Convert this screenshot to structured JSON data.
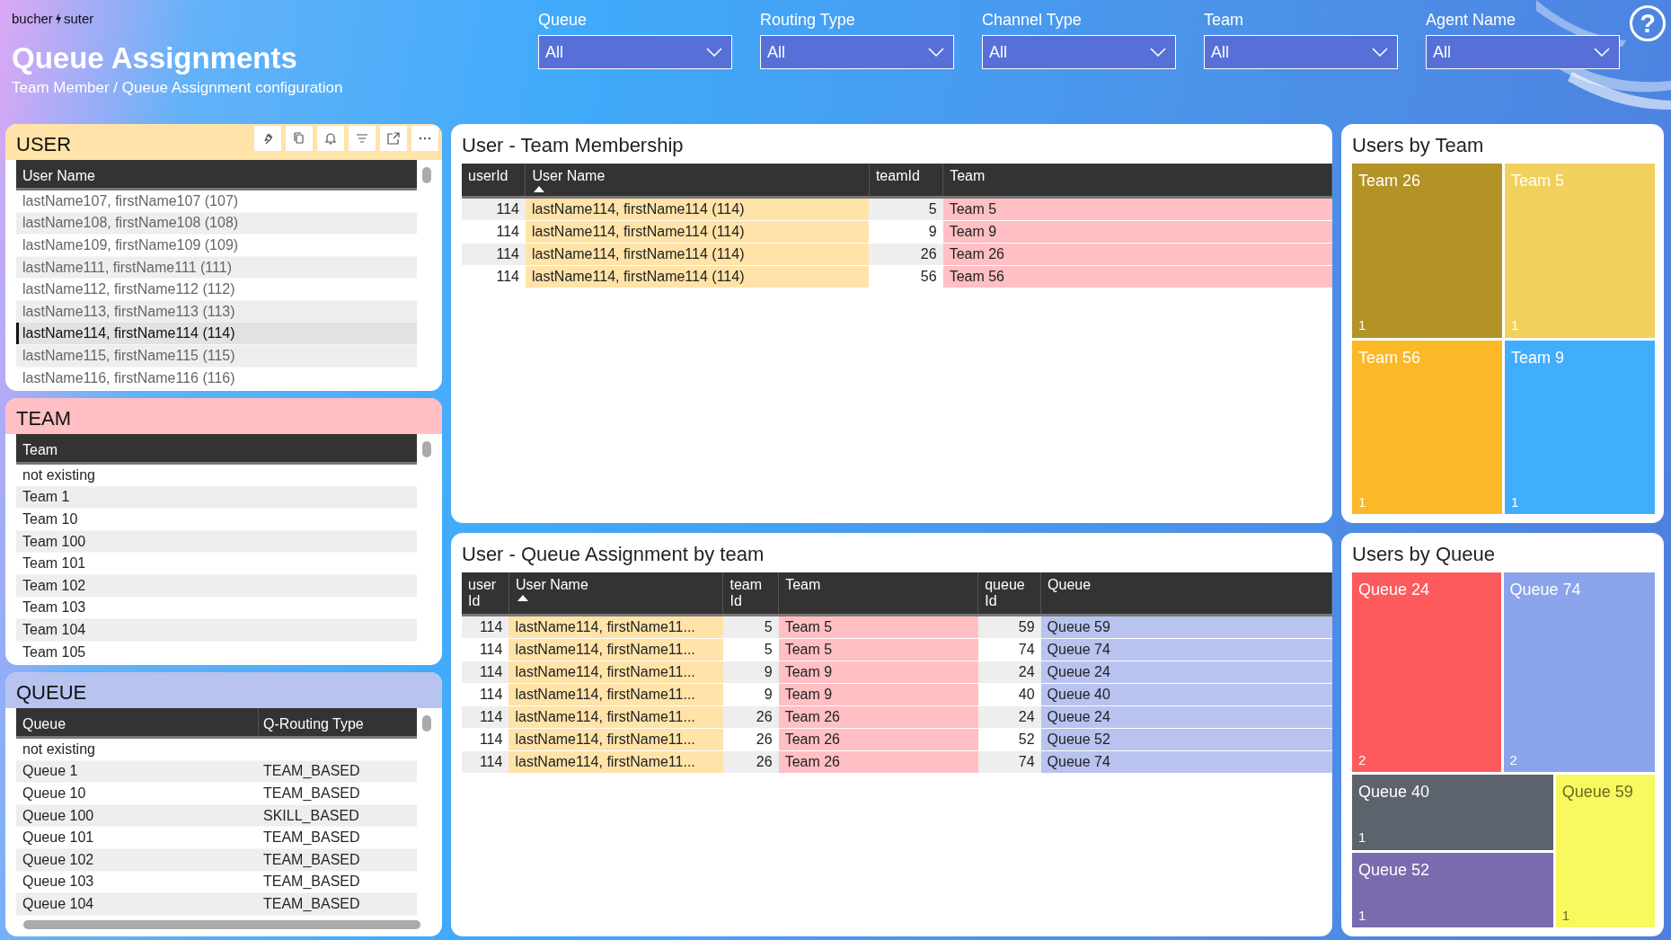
{
  "header": {
    "logo": [
      "bucher",
      "suter"
    ],
    "title": "Queue Assignments",
    "subtitle": "Team Member / Queue Assignment configuration",
    "help": "?"
  },
  "filters": [
    {
      "label": "Queue",
      "value": "All"
    },
    {
      "label": "Routing Type",
      "value": "All"
    },
    {
      "label": "Channel Type",
      "value": "All"
    },
    {
      "label": "Team",
      "value": "All"
    },
    {
      "label": "Agent Name",
      "value": "All"
    }
  ],
  "user_panel": {
    "title": "USER",
    "column": "User Name",
    "items": [
      {
        "text": "lastName107, firstName107 (107)",
        "selected": false
      },
      {
        "text": "lastName108, firstName108 (108)",
        "selected": false
      },
      {
        "text": "lastName109, firstName109 (109)",
        "selected": false
      },
      {
        "text": "lastName111, firstName111 (111)",
        "selected": false
      },
      {
        "text": "lastName112, firstName112 (112)",
        "selected": false
      },
      {
        "text": "lastName113, firstName113 (113)",
        "selected": false
      },
      {
        "text": "lastName114, firstName114 (114)",
        "selected": true
      },
      {
        "text": "lastName115, firstName115 (115)",
        "selected": false
      },
      {
        "text": "lastName116, firstName116 (116)",
        "selected": false
      }
    ]
  },
  "team_panel": {
    "title": "TEAM",
    "column": "Team",
    "items": [
      "not existing",
      "Team 1",
      "Team 10",
      "Team 100",
      "Team 101",
      "Team 102",
      "Team 103",
      "Team 104",
      "Team 105"
    ]
  },
  "queue_panel": {
    "title": "QUEUE",
    "columns": [
      "Queue",
      "Q-Routing Type"
    ],
    "rows": [
      {
        "queue": "not existing"
      },
      {
        "queue": "Queue 1",
        "routing_type": "TEAM_BASED"
      },
      {
        "queue": "Queue 10",
        "routing_type": "TEAM_BASED"
      },
      {
        "queue": "Queue 100",
        "routing_type": "SKILL_BASED"
      },
      {
        "queue": "Queue 101",
        "routing_type": "TEAM_BASED"
      },
      {
        "queue": "Queue 102",
        "routing_type": "TEAM_BASED"
      },
      {
        "queue": "Queue 103",
        "routing_type": "TEAM_BASED"
      },
      {
        "queue": "Queue 104",
        "routing_type": "TEAM_BASED"
      }
    ]
  },
  "membership": {
    "title": "User - Team Membership",
    "columns": [
      {
        "label": "userId",
        "kind": "id"
      },
      {
        "label": "User Name",
        "kind": "name",
        "color": "#ffe3a8",
        "sorted": true
      },
      {
        "label": "teamId",
        "kind": "id"
      },
      {
        "label": "Team",
        "kind": "name",
        "color": "#ffbfc3"
      }
    ],
    "rows": [
      [
        "114",
        "lastName114, firstName114 (114)",
        "5",
        "Team 5"
      ],
      [
        "114",
        "lastName114, firstName114 (114)",
        "9",
        "Team 9"
      ],
      [
        "114",
        "lastName114, firstName114 (114)",
        "26",
        "Team 26"
      ],
      [
        "114",
        "lastName114, firstName114 (114)",
        "56",
        "Team 56"
      ]
    ]
  },
  "assignments": {
    "title": "User - Queue Assignment by team",
    "columns": [
      {
        "label": "user Id",
        "kind": "id"
      },
      {
        "label": "User Name",
        "kind": "name",
        "color": "#ffe3a8",
        "sorted": true
      },
      {
        "label": "team Id",
        "kind": "id"
      },
      {
        "label": "Team",
        "kind": "name",
        "color": "#ffbfc3"
      },
      {
        "label": "queue Id",
        "kind": "id"
      },
      {
        "label": "Queue",
        "kind": "name",
        "color": "#b8c3f0"
      }
    ],
    "rows": [
      [
        "114",
        "lastName114, firstName11...",
        "5",
        "Team 5",
        "59",
        "Queue 59"
      ],
      [
        "114",
        "lastName114, firstName11...",
        "5",
        "Team 5",
        "74",
        "Queue 74"
      ],
      [
        "114",
        "lastName114, firstName11...",
        "9",
        "Team 9",
        "24",
        "Queue 24"
      ],
      [
        "114",
        "lastName114, firstName11...",
        "9",
        "Team 9",
        "40",
        "Queue 40"
      ],
      [
        "114",
        "lastName114, firstName11...",
        "26",
        "Team 26",
        "24",
        "Queue 24"
      ],
      [
        "114",
        "lastName114, firstName11...",
        "26",
        "Team 26",
        "52",
        "Queue 52"
      ],
      [
        "114",
        "lastName114, firstName11...",
        "26",
        "Team 26",
        "74",
        "Queue 74"
      ]
    ]
  },
  "users_by_team": {
    "title": "Users by Team",
    "tiles": [
      {
        "label": "Team 26",
        "count": "1",
        "color": "#b39226"
      },
      {
        "label": "Team 5",
        "count": "1",
        "color": "#f2d05c"
      },
      {
        "label": "Team 56",
        "count": "1",
        "color": "#fdb827"
      },
      {
        "label": "Team 9",
        "count": "1",
        "color": "#41aefc"
      }
    ]
  },
  "users_by_queue": {
    "title": "Users by Queue",
    "tiles": [
      {
        "label": "Queue 24",
        "count": "2",
        "color": "#fd5a5e"
      },
      {
        "label": "Queue 74",
        "count": "2",
        "color": "#8aa3ea"
      },
      {
        "label": "Queue 40",
        "count": "1",
        "color": "#5d636c"
      },
      {
        "label": "Queue 52",
        "count": "1",
        "color": "#7a6aae"
      },
      {
        "label": "Queue 59",
        "count": "1",
        "color": "#f7f95f"
      }
    ]
  }
}
